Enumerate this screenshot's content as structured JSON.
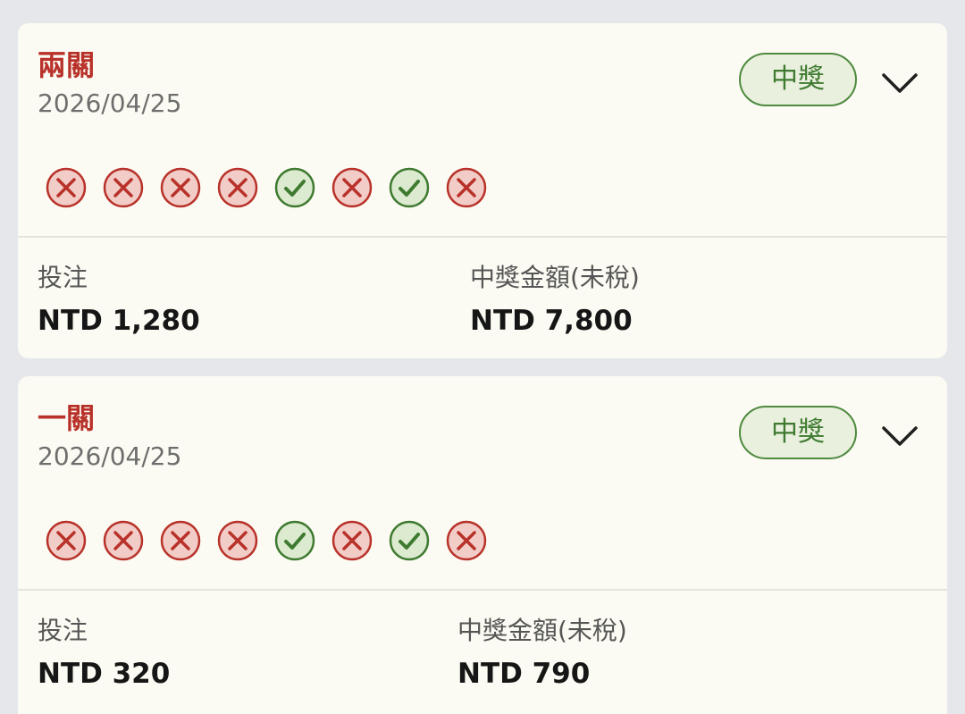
{
  "colors": {
    "page_background": "#e5e7ea",
    "card_background": "#fcfbf3",
    "title_red": "#b8322a",
    "win_green": "#3f7a31",
    "loss_red": "#b8322a",
    "loss_fill": "#f2cdc8",
    "win_fill": "#dcebd0"
  },
  "cards": [
    {
      "title": "兩關",
      "date": "2026/04/25",
      "status": "中獎",
      "results": [
        "loss",
        "loss",
        "loss",
        "loss",
        "win",
        "loss",
        "win",
        "loss"
      ],
      "stake_label": "投注",
      "stake_value": "NTD 1,280",
      "payout_label": "中獎金額(未稅)",
      "payout_value": "NTD 7,800"
    },
    {
      "title": "一關",
      "date": "2026/04/25",
      "status": "中獎",
      "results": [
        "loss",
        "loss",
        "loss",
        "loss",
        "win",
        "loss",
        "win",
        "loss"
      ],
      "stake_label": "投注",
      "stake_value": "NTD 320",
      "payout_label": "中獎金額(未稅)",
      "payout_value": "NTD 790"
    }
  ],
  "icons": {
    "expand": "chevron-down-icon",
    "win": "check-circle-icon",
    "loss": "x-circle-icon"
  }
}
